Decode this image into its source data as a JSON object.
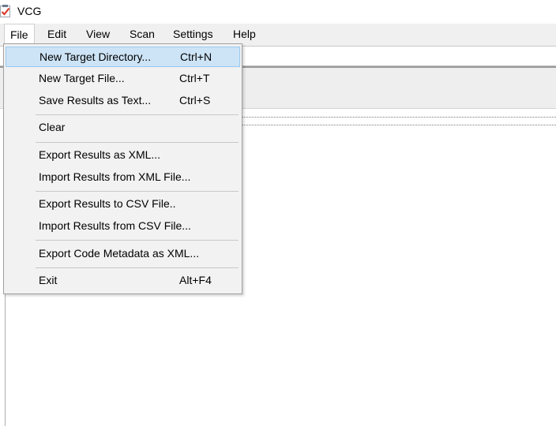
{
  "window": {
    "title": "VCG",
    "icon": "checklist-icon"
  },
  "menubar": {
    "items": [
      {
        "label": "File"
      },
      {
        "label": "Edit"
      },
      {
        "label": "View"
      },
      {
        "label": "Scan"
      },
      {
        "label": "Settings"
      },
      {
        "label": "Help"
      }
    ]
  },
  "file_menu": {
    "items": [
      {
        "label": "New Target Directory...",
        "shortcut": "Ctrl+N"
      },
      {
        "label": "New Target File...",
        "shortcut": "Ctrl+T"
      },
      {
        "label": "Save Results as Text...",
        "shortcut": "Ctrl+S"
      },
      {
        "label": "Clear",
        "shortcut": ""
      },
      {
        "label": "Export Results as XML...",
        "shortcut": ""
      },
      {
        "label": "Import Results from XML File...",
        "shortcut": ""
      },
      {
        "label": "Export Results to CSV File..",
        "shortcut": ""
      },
      {
        "label": "Import Results from CSV File...",
        "shortcut": ""
      },
      {
        "label": "Export Code Metadata as XML...",
        "shortcut": ""
      },
      {
        "label": "Exit",
        "shortcut": "Alt+F4"
      }
    ]
  },
  "colors": {
    "highlight": "#cde4f7",
    "highlight_border": "#99c9ef",
    "menu_bg": "#f2f2f2",
    "icon_red": "#d93a2b"
  }
}
